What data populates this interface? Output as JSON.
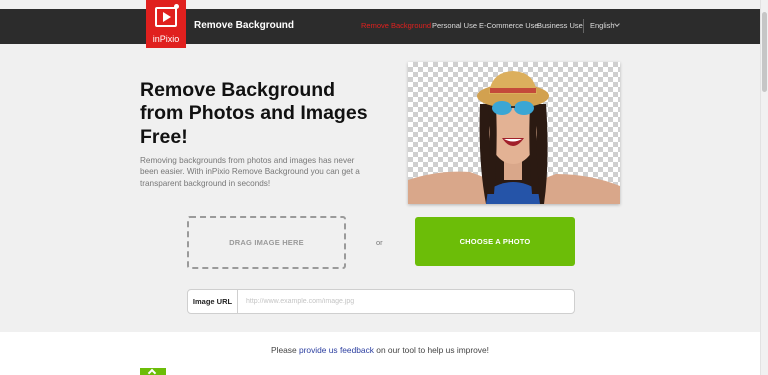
{
  "nav": {
    "logo_text": "inPixio",
    "brand": "Remove Background",
    "links": [
      "Remove Background",
      "Personal Use",
      "E-Commerce Use",
      "Business Use"
    ],
    "language": "English"
  },
  "hero": {
    "title": "Remove Background from Photos and Images Free!",
    "description": "Removing backgrounds from photos and images has never been easier. With inPixio Remove Background you can get a transparent background in seconds!"
  },
  "upload": {
    "drag_label": "DRAG IMAGE HERE",
    "or_label": "or",
    "choose_label": "CHOOSE A PHOTO"
  },
  "url": {
    "label": "Image URL",
    "placeholder": "http://www.example.com/image.jpg",
    "value": ""
  },
  "feedback": {
    "prefix": "Please ",
    "link": "provide us feedback",
    "suffix": " on our tool to help us improve!"
  },
  "colors": {
    "accent_red": "#e0201e",
    "accent_green": "#6cbd08",
    "nav_bg": "#2c2c2c",
    "link_blue": "#2b3ea0"
  }
}
